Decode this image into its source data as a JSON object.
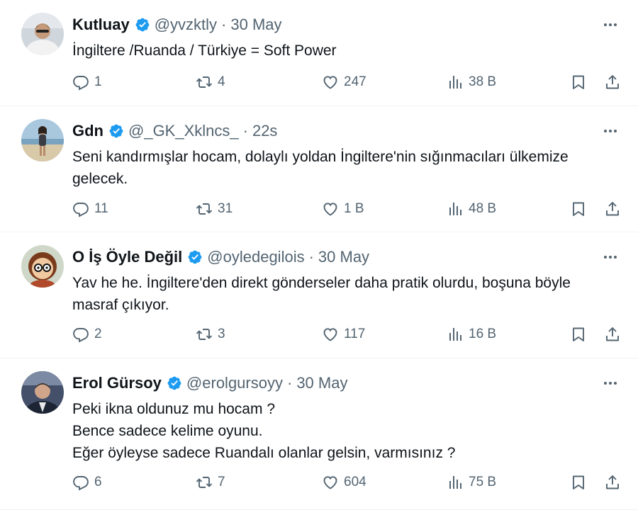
{
  "tweets": [
    {
      "name": "Kutluay",
      "handle": "@yvzktly",
      "dot": "·",
      "time": "30 May",
      "lines": [
        "İngiltere /Ruanda / Türkiye = Soft Power"
      ],
      "replies": "1",
      "retweets": "4",
      "likes": "247",
      "views": "38 B",
      "avatar_colors": {
        "bg": "#cfd6dc",
        "skin": "#c49a7a",
        "shirt": "#f2f2f2",
        "hair": "#3a302a"
      }
    },
    {
      "name": "Gdn",
      "handle": "@_GK_Xklncs_",
      "dot": "·",
      "time": "22s",
      "lines": [
        "Seni kandırmışlar hocam, dolaylı yoldan İngiltere'nin sığınmacıları ülkemize",
        "gelecek."
      ],
      "replies": "11",
      "retweets": "31",
      "likes": "1 B",
      "views": "48 B",
      "avatar_colors": {
        "bg": "#a9c8de",
        "skin": "#b88a6a",
        "shirt": "#3b3b44",
        "hair": "#2c221c"
      }
    },
    {
      "name": "O İş Öyle Değil",
      "handle": "@oyledegilois",
      "dot": "·",
      "time": "30 May",
      "lines": [
        "Yav he he. İngiltere'den direkt gönderseler daha pratik olurdu, boşuna böyle",
        "masraf çıkıyor."
      ],
      "replies": "2",
      "retweets": "3",
      "likes": "117",
      "views": "16 B",
      "avatar_colors": {
        "bg": "#cfd8c8",
        "skin": "#f0c9a0",
        "shirt": "#b04a2a",
        "hair": "#7a3b1c"
      }
    },
    {
      "name": "Erol Gürsoy",
      "handle": "@erolgursoyy",
      "dot": "·",
      "time": "30 May",
      "lines": [
        "Peki ikna oldunuz mu hocam ?",
        "Bence sadece kelime oyunu.",
        "Eğer öyleyse sadece Ruandalı olanlar gelsin, varmısınız ?"
      ],
      "replies": "6",
      "retweets": "7",
      "likes": "604",
      "views": "75 B",
      "avatar_colors": {
        "bg": "#44506a",
        "skin": "#d0a58a",
        "shirt": "#1d2433",
        "hair": "#1a1a1a"
      }
    }
  ],
  "colors": {
    "verified": "#1d9bf0",
    "muted": "#536471",
    "text": "#0f1419",
    "divider": "#eff3f4"
  },
  "icons": [
    "reply-icon",
    "retweet-icon",
    "like-icon",
    "views-icon",
    "bookmark-icon",
    "share-icon",
    "more-icon",
    "verified-badge-icon"
  ]
}
